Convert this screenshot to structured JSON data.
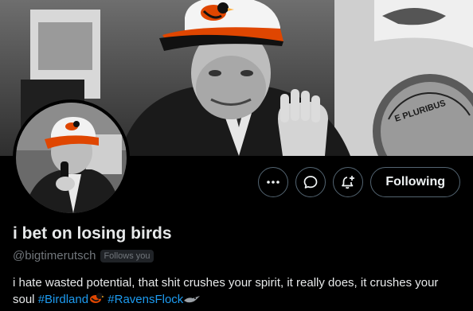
{
  "profile": {
    "display_name": "i bet on losing birds",
    "handle": "@bigtimerutsch",
    "follows_you_badge": "Follows you",
    "bio_text": "i hate wasted potential, that shit crushes your spirit, it really does, it crushes your soul",
    "hashtags": [
      "#Birdland",
      "#RavensFlock"
    ],
    "bio_emojis": [
      "oriole-bird-icon",
      "raven-bird-icon"
    ]
  },
  "banner": {
    "background_text": "E PLURIBUS"
  },
  "actions": {
    "more_icon": "more-horizontal-icon",
    "message_icon": "message-bubble-icon",
    "notify_icon": "bell-plus-icon",
    "follow_label": "Following"
  },
  "colors": {
    "background": "#000000",
    "text_primary": "#e7e9ea",
    "text_secondary": "#71767b",
    "link": "#1d9bf0",
    "button_border": "#536471",
    "orioles_orange": "#df4601"
  }
}
